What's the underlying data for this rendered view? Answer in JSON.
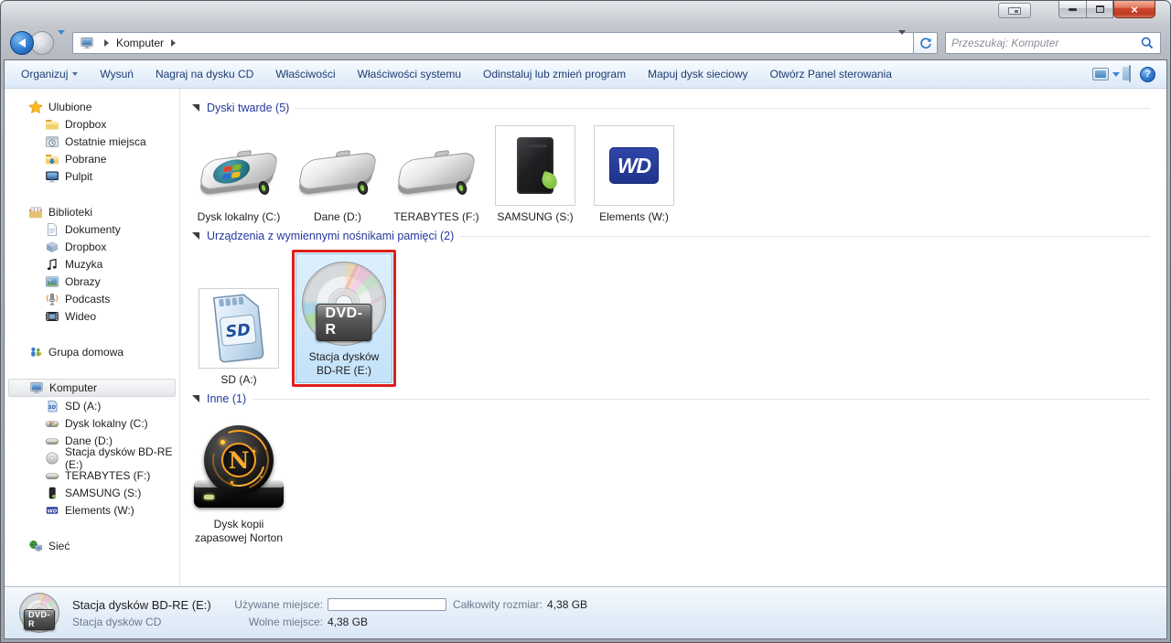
{
  "titlebar": {
    "utility_button_icon": "display-toggle-icon",
    "buttons": [
      "minimize",
      "maximize",
      "close"
    ]
  },
  "nav": {
    "breadcrumb": {
      "root_icon": "computer-icon",
      "items": [
        "Komputer"
      ]
    },
    "search_placeholder": "Przeszukaj: Komputer"
  },
  "toolbar": {
    "items": [
      {
        "label": "Organizuj",
        "dropdown": true
      },
      {
        "label": "Wysuń",
        "dropdown": false
      },
      {
        "label": "Nagraj na dysku CD",
        "dropdown": false
      },
      {
        "label": "Właściwości",
        "dropdown": false
      },
      {
        "label": "Właściwości systemu",
        "dropdown": false
      },
      {
        "label": "Odinstaluj lub zmień program",
        "dropdown": false
      },
      {
        "label": "Mapuj dysk sieciowy",
        "dropdown": false
      },
      {
        "label": "Otwórz Panel sterowania",
        "dropdown": false
      }
    ]
  },
  "sidebar": {
    "favorites": {
      "label": "Ulubione",
      "items": [
        "Dropbox",
        "Ostatnie miejsca",
        "Pobrane",
        "Pulpit"
      ]
    },
    "libraries": {
      "label": "Biblioteki",
      "items": [
        "Dokumenty",
        "Dropbox",
        "Muzyka",
        "Obrazy",
        "Podcasts",
        "Wideo"
      ]
    },
    "homegroup": {
      "label": "Grupa domowa"
    },
    "computer": {
      "label": "Komputer",
      "selected": true,
      "items": [
        "SD (A:)",
        "Dysk lokalny (C:)",
        "Dane (D:)",
        "Stacja dysków BD-RE (E:)",
        "TERABYTES (F:)",
        "SAMSUNG (S:)",
        "Elements (W:)"
      ]
    },
    "network": {
      "label": "Sieć"
    }
  },
  "main": {
    "sections": [
      {
        "title": "Dyski twarde",
        "count": "(5)"
      },
      {
        "title": "Urządzenia z wymiennymi nośnikami pamięci",
        "count": "(2)"
      },
      {
        "title": "Inne",
        "count": "(1)"
      }
    ],
    "drives": {
      "c": {
        "label": "Dysk lokalny (C:)"
      },
      "d": {
        "label": "Dane (D:)"
      },
      "f": {
        "label": "TERABYTES (F:)"
      },
      "s": {
        "label": "SAMSUNG (S:)"
      },
      "w": {
        "label": "Elements (W:)",
        "logo": "WD"
      }
    },
    "removable": {
      "sd": {
        "label": "SD (A:)",
        "card_text": "SD"
      },
      "dvd": {
        "line1": "Stacja dysków",
        "line2": "BD-RE (E:)",
        "badge": "DVD-R",
        "selected": true,
        "red_annotation": true
      }
    },
    "other": {
      "norton": {
        "line1": "Dysk kopii",
        "line2": "zapasowej Norton",
        "letter": "N"
      }
    }
  },
  "details": {
    "badge": "DVD-R",
    "title": "Stacja dysków BD-RE (E:)",
    "subtitle": "Stacja dysków CD",
    "used_label": "Używane miejsce:",
    "used_fraction": 0,
    "total_label": "Całkowity rozmiar:",
    "total_value": "4,38 GB",
    "free_label": "Wolne miejsce:",
    "free_value": "4,38 GB"
  },
  "colors": {
    "selection_fill": "#cde7fb",
    "selection_border": "#86c2ea",
    "annotation_red": "#e01c1c",
    "section_header_text": "#23389c",
    "toolbar_text": "#1e3c71"
  }
}
